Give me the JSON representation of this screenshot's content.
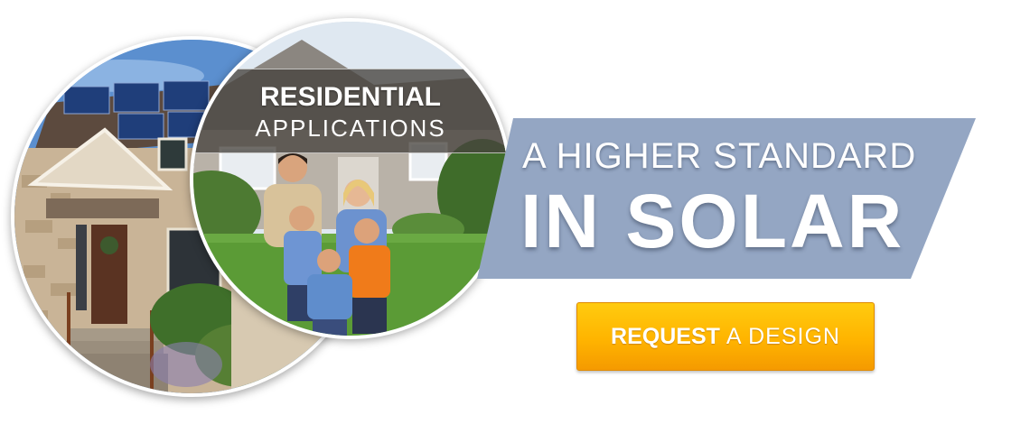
{
  "residential": {
    "title": "RESIDENTIAL",
    "subtitle": "APPLICATIONS"
  },
  "headline": {
    "line1": "A HIGHER STANDARD",
    "line2": "IN SOLAR"
  },
  "cta": {
    "bold": "REQUEST",
    "rest": "A DESIGN"
  },
  "colors": {
    "ribbon": "#94a6c3",
    "cta": "#ffb400",
    "banner": "#46423e"
  }
}
